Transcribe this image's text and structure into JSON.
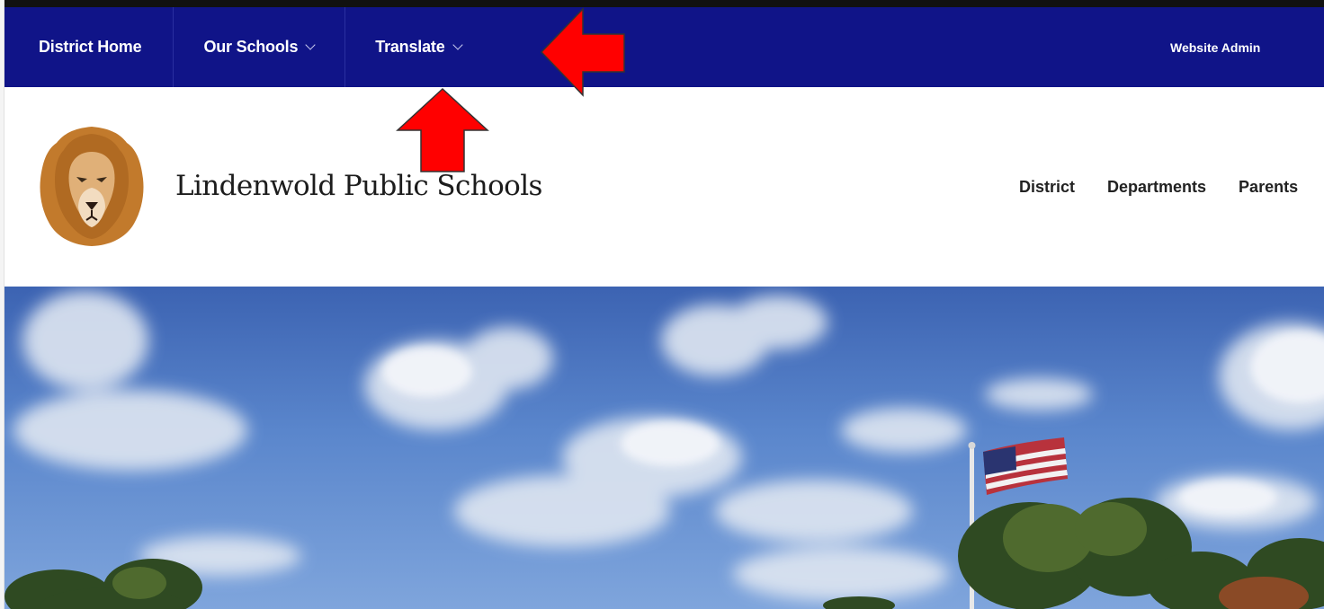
{
  "topnav": {
    "items": [
      {
        "label": "District Home"
      },
      {
        "label": "Our Schools"
      },
      {
        "label": "Translate"
      }
    ],
    "admin_label": "Website Admin"
  },
  "header": {
    "school_name": "Lindenwold Public Schools",
    "logo_icon": "lion-icon",
    "nav": [
      {
        "label": "District"
      },
      {
        "label": "Departments"
      },
      {
        "label": "Parents"
      }
    ]
  },
  "hero": {
    "image": "flagpole-sky-photo"
  },
  "annotations": {
    "arrow_color": "#ff0000"
  },
  "colors": {
    "nav_bg": "#101488",
    "header_bg": "#ffffff"
  }
}
